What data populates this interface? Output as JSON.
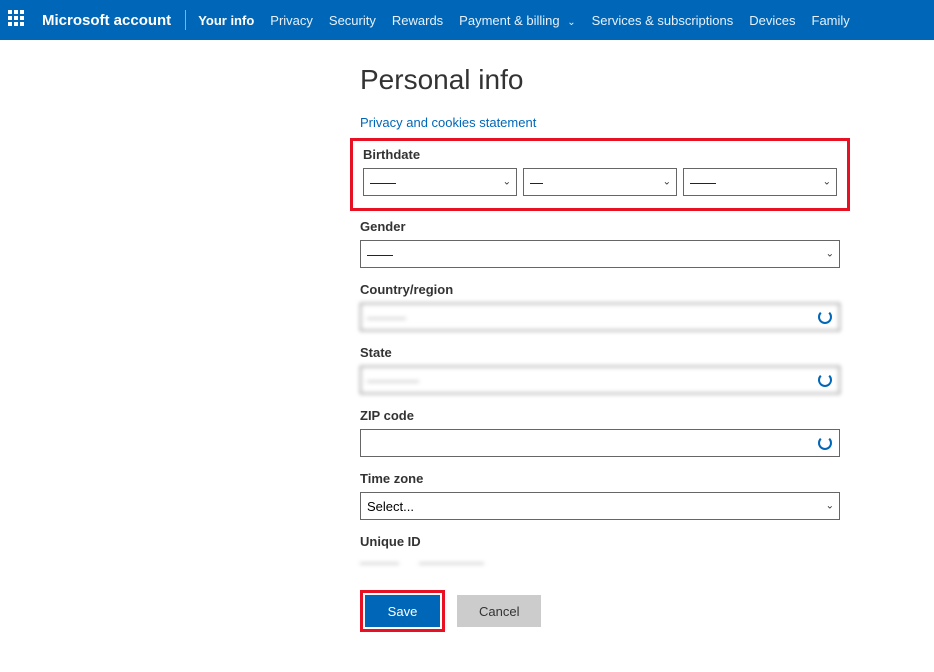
{
  "nav": {
    "brand": "Microsoft account",
    "items": [
      {
        "label": "Your info",
        "active": true
      },
      {
        "label": "Privacy",
        "active": false
      },
      {
        "label": "Security",
        "active": false
      },
      {
        "label": "Rewards",
        "active": false
      },
      {
        "label": "Payment & billing",
        "active": false,
        "dropdown": true
      },
      {
        "label": "Services & subscriptions",
        "active": false
      },
      {
        "label": "Devices",
        "active": false
      },
      {
        "label": "Family",
        "active": false
      }
    ]
  },
  "page": {
    "title": "Personal info",
    "privacy_link": "Privacy and cookies statement"
  },
  "fields": {
    "birthdate": {
      "label": "Birthdate",
      "month": "——",
      "day": "—",
      "year": "——"
    },
    "gender": {
      "label": "Gender",
      "value": "——"
    },
    "country": {
      "label": "Country/region",
      "value": "———"
    },
    "state": {
      "label": "State",
      "value": "————"
    },
    "zip": {
      "label": "ZIP code",
      "value": ""
    },
    "timezone": {
      "label": "Time zone",
      "value": "Select..."
    },
    "unique_id": {
      "label": "Unique ID",
      "val1": "———",
      "val2": "—————"
    }
  },
  "buttons": {
    "save": "Save",
    "cancel": "Cancel"
  }
}
